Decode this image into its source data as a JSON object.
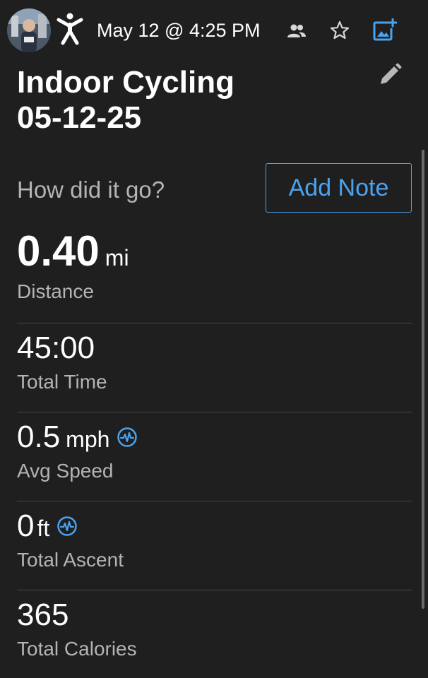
{
  "header": {
    "date_time": "May 12 @ 4:25 PM",
    "avatar_icon": "user-avatar",
    "activity_icon": "person-exercise-icon",
    "people_icon": "people-icon",
    "favorite_icon": "star-outline-icon",
    "photo_icon": "add-photo-icon"
  },
  "activity": {
    "title_line1": "Indoor Cycling",
    "title_line2": "05-12-25",
    "edit_icon": "pencil-icon"
  },
  "feedback": {
    "prompt": "How did it go?",
    "add_note_label": "Add Note"
  },
  "stats": [
    {
      "value": "0.40",
      "unit": "mi",
      "label": "Distance",
      "sensor_icon": false
    },
    {
      "value": "45:00",
      "unit": "",
      "label": "Total Time",
      "sensor_icon": false
    },
    {
      "value": "0.5",
      "unit": "mph",
      "label": "Avg Speed",
      "sensor_icon": true
    },
    {
      "value": "0",
      "unit": "ft",
      "label": "Total Ascent",
      "sensor_icon": true
    },
    {
      "value": "365",
      "unit": "",
      "label": "Total Calories",
      "sensor_icon": false
    }
  ],
  "colors": {
    "background": "#1f1f1f",
    "accent": "#4aa3ef",
    "secondary_text": "#b4b4b4",
    "divider": "#474747"
  }
}
